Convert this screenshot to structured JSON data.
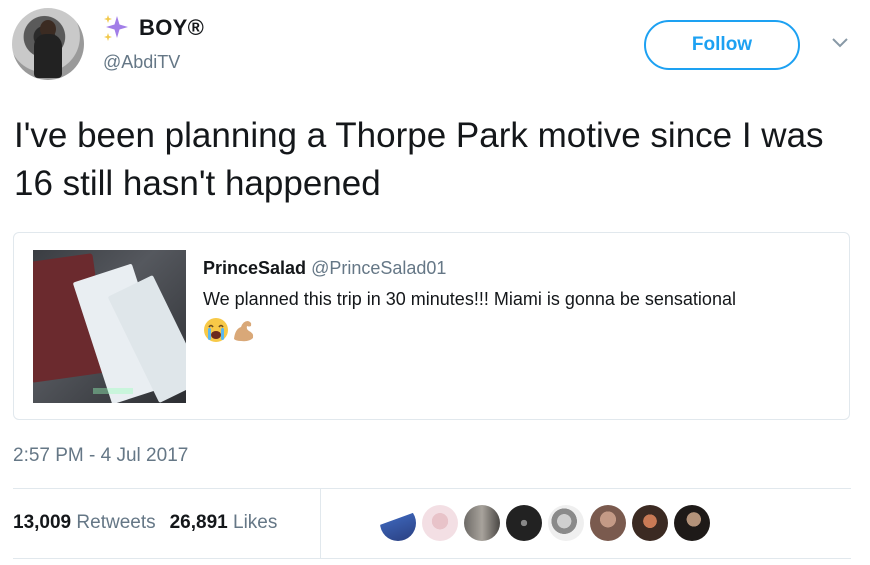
{
  "author": {
    "display_name": "BOY®",
    "handle": "@AbdiTV",
    "follow_label": "Follow"
  },
  "tweet": {
    "text": "I've been planning a Thorpe Park motive since I was 16 still hasn't happened",
    "timestamp": "2:57 PM - 4 Jul 2017"
  },
  "quoted_tweet": {
    "name": "PrinceSalad",
    "handle": "@PrinceSalad01",
    "text": "We planned this trip in 30 minutes!!! Miami is gonna be sensational",
    "emojis": [
      "crying-face-icon",
      "flexed-biceps-icon"
    ]
  },
  "stats": {
    "retweets_count": "13,009",
    "retweets_label": "Retweets",
    "likes_count": "26,891",
    "likes_label": "Likes"
  },
  "likers": [
    "liker-1",
    "liker-2",
    "liker-3",
    "liker-4",
    "liker-5",
    "liker-6",
    "liker-7",
    "liker-8"
  ],
  "colors": {
    "accent": "#1da1f2",
    "secondary_text": "#657786",
    "border": "#e1e8ed",
    "sparkle": "#a27ee8"
  }
}
